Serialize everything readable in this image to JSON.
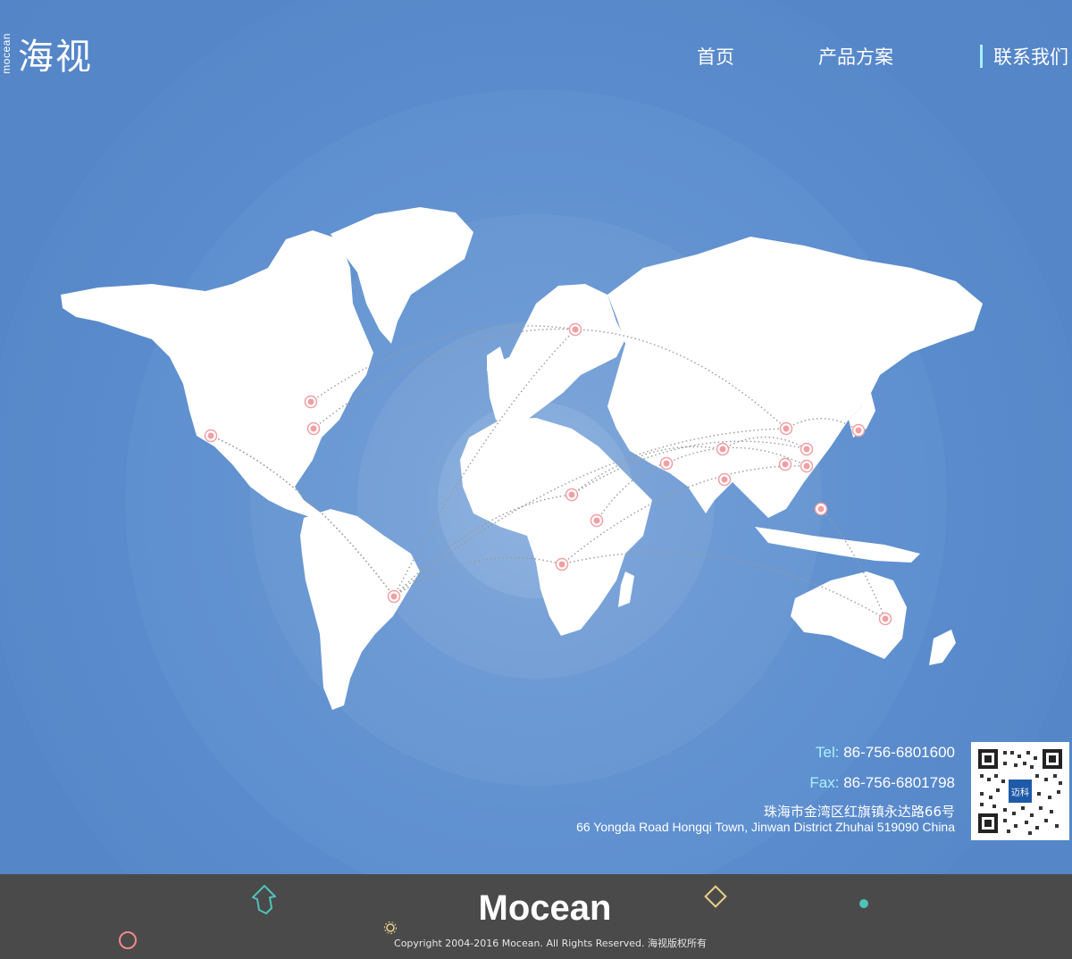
{
  "header": {
    "logo_main": "海视",
    "logo_sub": "mocean",
    "nav": [
      {
        "label": "首页",
        "active": false
      },
      {
        "label": "产品方案",
        "active": false
      },
      {
        "label": "联系我们",
        "active": true
      }
    ]
  },
  "map": {
    "hub_color": "#f0a0a4",
    "route_color": "#9a9a9a",
    "land_color": "#ffffff",
    "office_count": 21
  },
  "contact": {
    "tel_label": "Tel:",
    "tel": "86-756-6801600",
    "fax_label": "Fax:",
    "fax": "86-756-6801798",
    "address_cn": "珠海市金湾区红旗镇永达路66号",
    "address_en": "66 Yongda Road Hongqi Town, Jinwan District Zhuhai 519090 China",
    "qr_badge": "迈科"
  },
  "footer": {
    "brand": "Mocean",
    "copyright": "Copyright 2004-2016 Mocean. All Rights Reserved. 海视版权所有",
    "icons": [
      "hand-pointer-icon",
      "diamond-icon",
      "dot-icon",
      "circle-icon",
      "gear-icon"
    ],
    "icon_colors": {
      "hand": "#4fc3b8",
      "diamond": "#e8d08a",
      "dot": "#4fc3b8",
      "circle": "#f08a8a",
      "gear": "#e8d08a"
    }
  }
}
